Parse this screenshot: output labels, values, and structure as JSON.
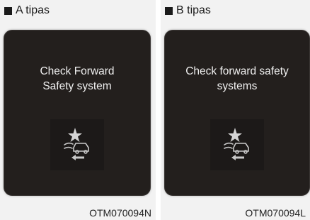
{
  "panels": [
    {
      "label": "A tipas",
      "message_line1": "Check Forward",
      "message_line2": "Safety system",
      "icon": "forward-collision-warning-icon",
      "caption": "OTM070094N"
    },
    {
      "label": "B tipas",
      "message_line1": "Check forward safety",
      "message_line2": "systems",
      "icon": "forward-collision-warning-icon",
      "caption": "OTM070094L"
    }
  ],
  "colors": {
    "screen_background": "#231f1d",
    "icon_color": "#c9c9c9",
    "page_background": "#f2f2f2"
  }
}
